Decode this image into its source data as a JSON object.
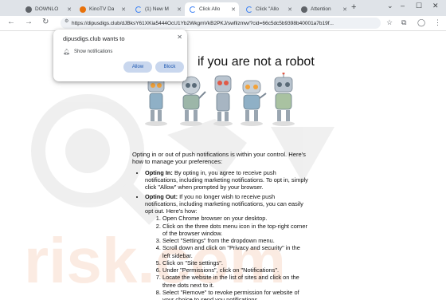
{
  "tabs": [
    {
      "label": "DOWNLO",
      "icon": "generic-icon",
      "color": "#5f6368",
      "active": false
    },
    {
      "label": "KinoTV Da",
      "icon": "kino-icon",
      "color": "#e8710a",
      "active": false
    },
    {
      "label": "(1) New M",
      "icon": "loading-icon",
      "color": "#4285f4",
      "active": false
    },
    {
      "label": "Click Allo",
      "icon": "loading-icon",
      "color": "#4285f4",
      "active": true
    },
    {
      "label": "Click \"Allo",
      "icon": "loading-icon",
      "color": "#4285f4",
      "active": false
    },
    {
      "label": "Attention",
      "icon": "globe-icon",
      "color": "#5f6368",
      "active": false
    }
  ],
  "toolbar": {
    "url": "https://dipusdigs.club/dJBksY61XKia5444OcU1Yb2WkgmVkB2PKJ/swfilzmw/?cid=66c5dc5b9398b40001a7b19f..."
  },
  "popup": {
    "title": "dipusdigs.club wants to",
    "permission": "Show notifications",
    "allow": "Allow",
    "block": "Block"
  },
  "page": {
    "headline": "if you are not  a robot",
    "intro": "Opting in or out of push notifications is within your control. Here's how to manage your preferences:",
    "opt_in_label": "Opting In:",
    "opt_in_text": " By opting in, you agree to receive push notifications, including marketing notifications. To opt in, simply click \"Allow\" when prompted by your browser.",
    "opt_out_label": "Opting Out:",
    "opt_out_text": " If you no longer wish to receive push notifications, including marketing notifications, you can easily opt out. Here's how:",
    "steps": [
      "Open Chrome browser on your desktop.",
      "Click on the three dots menu icon in the top-right corner of the browser window.",
      "Select \"Settings\" from the dropdown menu.",
      "Scroll down and click on \"Privacy and security\" in the left sidebar.",
      "Click on \"Site settings\".",
      "Under \"Permissions\", click on \"Notifications\".",
      "Locate the website in the list of sites and click on the three dots next to it.",
      "Select \"Remove\" to revoke permission for website of your choice to send you notifications."
    ]
  },
  "watermark": {
    "text": "risk.com"
  }
}
